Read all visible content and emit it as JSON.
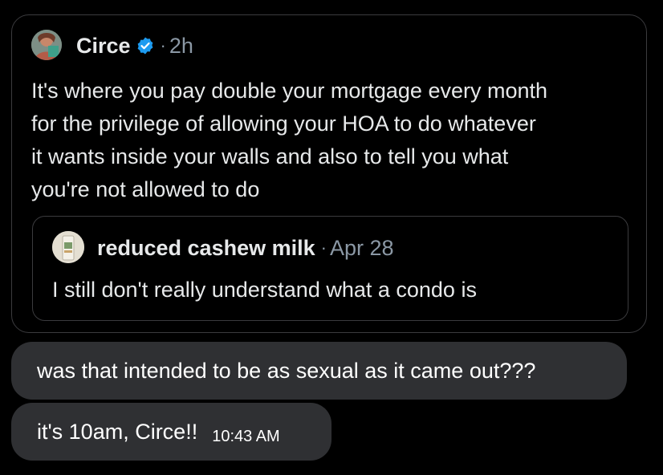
{
  "tweet": {
    "author": "Circe",
    "separator": "·",
    "time": "2h",
    "verified": true,
    "verified_color": "#1d9bf0",
    "text_lines": [
      "It's where you pay double your mortgage every month",
      "for the privilege of allowing your HOA to do whatever",
      "it wants inside your walls and also to tell you what",
      "you're not allowed to do"
    ]
  },
  "quote": {
    "author": "reduced cashew milk",
    "separator": "·",
    "date": "Apr 28",
    "text": "I still don't really understand what a condo is"
  },
  "messages": [
    {
      "text": "was that intended to be as sexual as it came out???"
    },
    {
      "text": "it's 10am, Circe!!",
      "time": "10:43 AM"
    }
  ],
  "icons": {
    "verified": "verified-badge-icon",
    "author_avatar": "avatar",
    "quote_avatar": "avatar"
  },
  "colors": {
    "background": "#000000",
    "bubble": "#2f3033",
    "card_border": "#3b3b3e",
    "secondary_text": "#8b98a5"
  }
}
